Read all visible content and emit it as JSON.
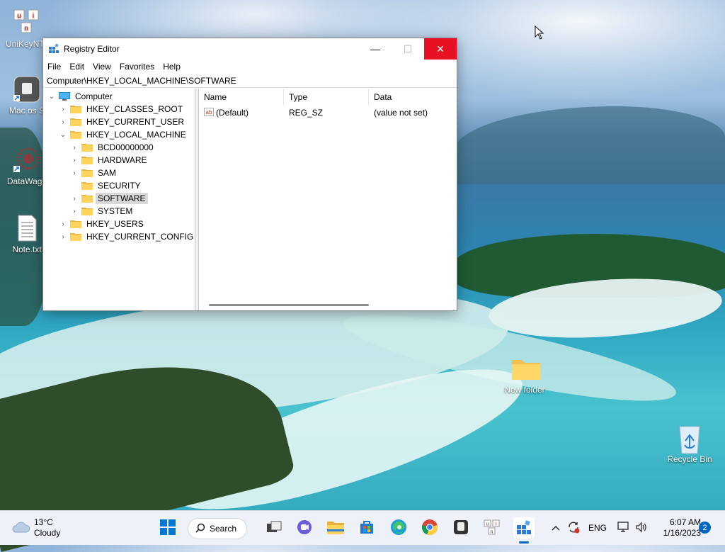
{
  "desktop": {
    "icons": [
      {
        "label": "UniKeyNTe"
      },
      {
        "label": "Mac os S"
      },
      {
        "label": "DataWago"
      },
      {
        "label": "Note.txt"
      },
      {
        "label": "New folder"
      },
      {
        "label": "Recycle Bin"
      }
    ]
  },
  "window": {
    "title": "Registry Editor",
    "minimize": "—",
    "maximize": "☐",
    "close": "✕",
    "menu": [
      "File",
      "Edit",
      "View",
      "Favorites",
      "Help"
    ],
    "address": "Computer\\HKEY_LOCAL_MACHINE\\SOFTWARE",
    "tree": [
      {
        "label": "Computer"
      },
      {
        "label": "HKEY_CLASSES_ROOT"
      },
      {
        "label": "HKEY_CURRENT_USER"
      },
      {
        "label": "HKEY_LOCAL_MACHINE"
      },
      {
        "label": "BCD00000000"
      },
      {
        "label": "HARDWARE"
      },
      {
        "label": "SAM"
      },
      {
        "label": "SECURITY"
      },
      {
        "label": "SOFTWARE"
      },
      {
        "label": "SYSTEM"
      },
      {
        "label": "HKEY_USERS"
      },
      {
        "label": "HKEY_CURRENT_CONFIG"
      }
    ],
    "columns": [
      "Name",
      "Type",
      "Data"
    ],
    "rows": [
      {
        "name": "(Default)",
        "type": "REG_SZ",
        "data": "(value not set)"
      }
    ]
  },
  "taskbar": {
    "weather_temp": "13°C",
    "weather_desc": "Cloudy",
    "search_label": "Search",
    "language": "ENG",
    "time": "6:07 AM",
    "date": "1/16/2023",
    "notification_count": "2"
  },
  "colors": {
    "close_button": "#e81123",
    "accent": "#0067c0"
  }
}
